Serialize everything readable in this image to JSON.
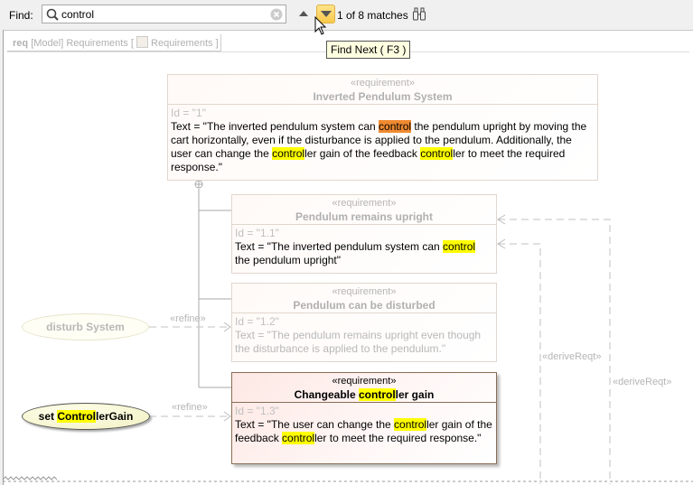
{
  "find": {
    "label": "Find:",
    "query": "control",
    "match_status": "1 of 8 matches",
    "tooltip": "Find Next ( F3 )"
  },
  "frame": {
    "kind": "req",
    "path": "[Model] Requirements [",
    "diagram": "Requirements",
    "close": "]"
  },
  "requirements": [
    {
      "stereotype": "«requirement»",
      "name": [
        {
          "t": "Inverted Pendulum System"
        }
      ],
      "id": "Id = \"1\"",
      "text": [
        {
          "t": "Text = \"The inverted pendulum system can "
        },
        {
          "t": "control",
          "h": "cur"
        },
        {
          "t": " the pendulum upright by moving the cart horizontally, even if the disturbance is applied to the pendulum. Additionally, the user can change the "
        },
        {
          "t": "control",
          "h": "m"
        },
        {
          "t": "ler gain of the feedback "
        },
        {
          "t": "control",
          "h": "m"
        },
        {
          "t": "ler to meet the required response.\""
        }
      ]
    },
    {
      "stereotype": "«requirement»",
      "name": [
        {
          "t": "Pendulum remains upright"
        }
      ],
      "id": "Id = \"1.1\"",
      "text": [
        {
          "t": "Text = \"The inverted pendulum system can "
        },
        {
          "t": "control",
          "h": "m"
        },
        {
          "t": " the pendulum upright\""
        }
      ]
    },
    {
      "stereotype": "«requirement»",
      "name": [
        {
          "t": "Pendulum can be disturbed"
        }
      ],
      "id": "Id = \"1.2\"",
      "text": [
        {
          "t": "Text = \"The pendulum remains upright even though the disturbance is applied to the pendulum.\""
        }
      ],
      "faded": true
    },
    {
      "stereotype": "«requirement»",
      "name": [
        {
          "t": "Changeable "
        },
        {
          "t": "control",
          "h": "m"
        },
        {
          "t": "ler gain"
        }
      ],
      "id": "Id = \"1.3\"",
      "text": [
        {
          "t": "Text = \"The user can change the "
        },
        {
          "t": "control",
          "h": "m"
        },
        {
          "t": "ler gain of the feedback "
        },
        {
          "t": "control",
          "h": "m"
        },
        {
          "t": "ler to meet the required response.\""
        }
      ]
    }
  ],
  "use_cases": [
    {
      "name": [
        {
          "t": "disturb System"
        }
      ]
    },
    {
      "name": [
        {
          "t": "set "
        },
        {
          "t": "Control",
          "h": "m"
        },
        {
          "t": "lerGain"
        }
      ]
    }
  ],
  "relations": {
    "refine_1": "«refine»",
    "refine_2": "«refine»",
    "derive_1": "«deriveReqt»",
    "derive_2": "«deriveReqt»"
  }
}
